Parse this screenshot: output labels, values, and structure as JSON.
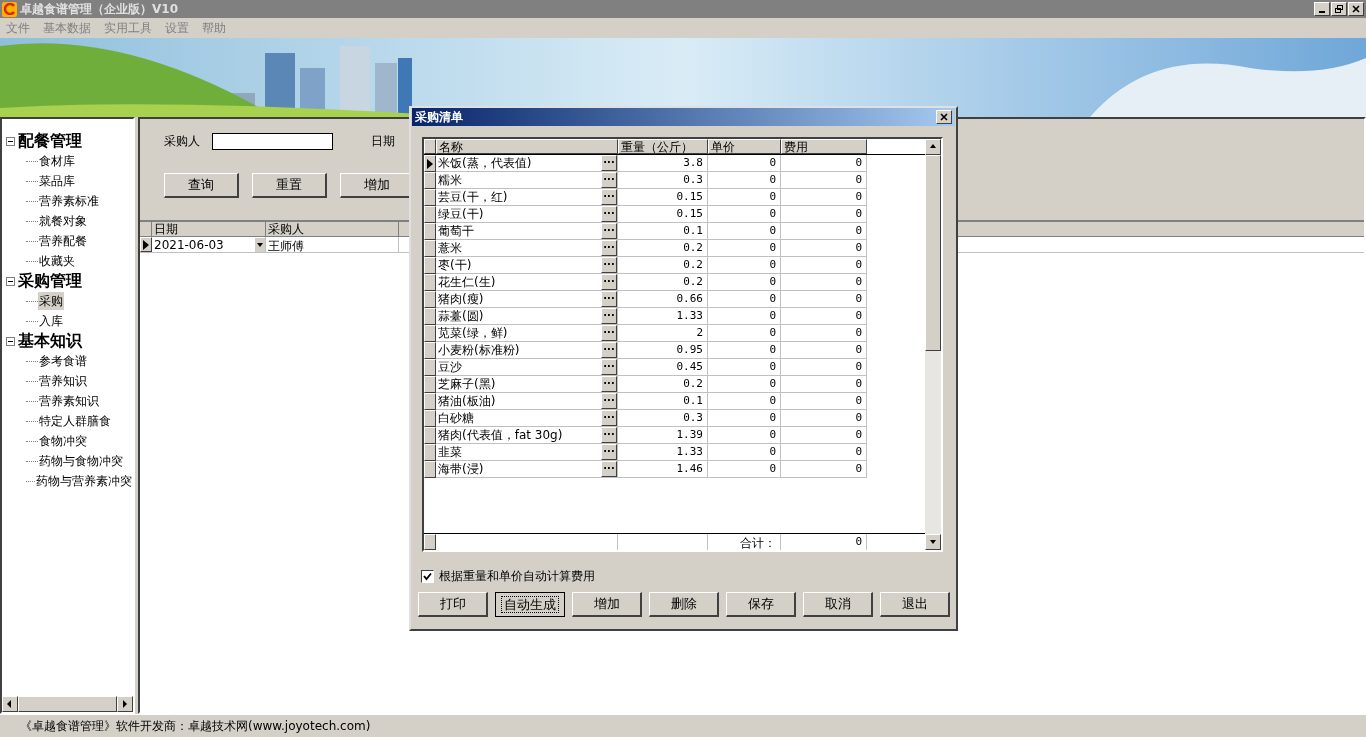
{
  "window": {
    "title": "卓越食谱管理（企业版）V10"
  },
  "menu": [
    "文件",
    "基本数据",
    "实用工具",
    "设置",
    "帮助"
  ],
  "sidebar": {
    "groups": [
      {
        "label": "配餐管理",
        "expanded": true,
        "children": [
          {
            "label": "食材库",
            "selected": false
          },
          {
            "label": "菜品库",
            "selected": false
          },
          {
            "label": "营养素标准",
            "selected": false
          },
          {
            "label": "就餐对象",
            "selected": false
          },
          {
            "label": "营养配餐",
            "selected": false
          },
          {
            "label": "收藏夹",
            "selected": false
          }
        ]
      },
      {
        "label": "采购管理",
        "expanded": true,
        "children": [
          {
            "label": "采购",
            "selected": true
          },
          {
            "label": "入库",
            "selected": false
          }
        ]
      },
      {
        "label": "基本知识",
        "expanded": true,
        "children": [
          {
            "label": "参考食谱",
            "selected": false
          },
          {
            "label": "营养知识",
            "selected": false
          },
          {
            "label": "营养素知识",
            "selected": false
          },
          {
            "label": "特定人群膳食",
            "selected": false
          },
          {
            "label": "食物冲突",
            "selected": false
          },
          {
            "label": "药物与食物冲突",
            "selected": false
          },
          {
            "label": "药物与营养素冲突",
            "selected": false
          }
        ]
      }
    ]
  },
  "query": {
    "buyer_label": "采购人",
    "date_label": "日期",
    "buttons": [
      "查询",
      "重置",
      "增加"
    ]
  },
  "list": {
    "columns": [
      "日期",
      "采购人"
    ],
    "rows": [
      {
        "date": "2021-06-03",
        "buyer": "王师傅",
        "current": true
      }
    ]
  },
  "dialog": {
    "title": "采购清单",
    "columns": [
      "名称",
      "重量（公斤）",
      "单价",
      "费用"
    ],
    "rows": [
      {
        "name": "米饭(蒸，代表值)",
        "weight": "3.8",
        "price": "0",
        "cost": "0",
        "current": true
      },
      {
        "name": "糯米",
        "weight": "0.3",
        "price": "0",
        "cost": "0",
        "current": false
      },
      {
        "name": "芸豆(干，红)",
        "weight": "0.15",
        "price": "0",
        "cost": "0",
        "current": false
      },
      {
        "name": "绿豆(干)",
        "weight": "0.15",
        "price": "0",
        "cost": "0",
        "current": false
      },
      {
        "name": "葡萄干",
        "weight": "0.1",
        "price": "0",
        "cost": "0",
        "current": false
      },
      {
        "name": "薏米",
        "weight": "0.2",
        "price": "0",
        "cost": "0",
        "current": false
      },
      {
        "name": "枣(干)",
        "weight": "0.2",
        "price": "0",
        "cost": "0",
        "current": false
      },
      {
        "name": "花生仁(生)",
        "weight": "0.2",
        "price": "0",
        "cost": "0",
        "current": false
      },
      {
        "name": "猪肉(瘦)",
        "weight": "0.66",
        "price": "0",
        "cost": "0",
        "current": false
      },
      {
        "name": "蒜薹(圆)",
        "weight": "1.33",
        "price": "0",
        "cost": "0",
        "current": false
      },
      {
        "name": "苋菜(绿，鲜)",
        "weight": "2",
        "price": "0",
        "cost": "0",
        "current": false
      },
      {
        "name": "小麦粉(标准粉)",
        "weight": "0.95",
        "price": "0",
        "cost": "0",
        "current": false
      },
      {
        "name": "豆沙",
        "weight": "0.45",
        "price": "0",
        "cost": "0",
        "current": false
      },
      {
        "name": "芝麻子(黑)",
        "weight": "0.2",
        "price": "0",
        "cost": "0",
        "current": false
      },
      {
        "name": "猪油(板油)",
        "weight": "0.1",
        "price": "0",
        "cost": "0",
        "current": false
      },
      {
        "name": "白砂糖",
        "weight": "0.3",
        "price": "0",
        "cost": "0",
        "current": false
      },
      {
        "name": "猪肉(代表值，fat 30g)",
        "weight": "1.39",
        "price": "0",
        "cost": "0",
        "current": false
      },
      {
        "name": "韭菜",
        "weight": "1.33",
        "price": "0",
        "cost": "0",
        "current": false
      },
      {
        "name": "海带(浸)",
        "weight": "1.46",
        "price": "0",
        "cost": "0",
        "current": false
      }
    ],
    "ellipsis": "···",
    "total_label": "合计：",
    "total_value": "0",
    "auto_calc": {
      "label": "根据重量和单价自动计算费用",
      "checked": true
    },
    "buttons": [
      {
        "label": "打印",
        "focused": false
      },
      {
        "label": "自动生成",
        "focused": true
      },
      {
        "label": "增加",
        "focused": false
      },
      {
        "label": "删除",
        "focused": false
      },
      {
        "label": "保存",
        "focused": false
      },
      {
        "label": "取消",
        "focused": false
      },
      {
        "label": "退出",
        "focused": false
      }
    ]
  },
  "status_bar": "《卓越食谱管理》软件开发商：卓越技术网(www.joyotech.com)"
}
